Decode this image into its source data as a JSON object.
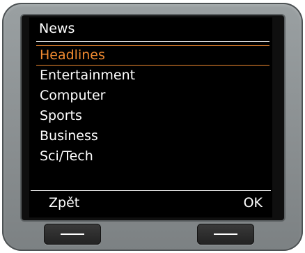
{
  "screen": {
    "title": "News",
    "menu_items": [
      "Headlines",
      "Entertainment",
      "Computer",
      "Sports",
      "Business",
      "Sci/Tech"
    ],
    "selected_index": 0,
    "softkeys": {
      "left": "Zpět",
      "right": "OK"
    }
  },
  "colors": {
    "highlight": "#f08a30",
    "screen_bg": "#000000",
    "device_body": "#8f9496"
  },
  "icons": {
    "left_hardware_key": "dash-icon",
    "right_hardware_key": "dash-icon"
  }
}
